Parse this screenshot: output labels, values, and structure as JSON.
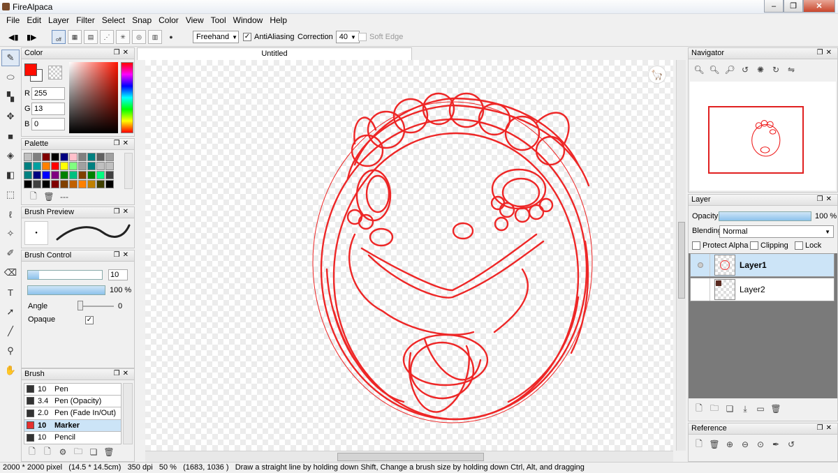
{
  "window": {
    "title": "FireAlpaca",
    "min": "–",
    "max": "❐",
    "close": "✕"
  },
  "menu": [
    "File",
    "Edit",
    "Layer",
    "Filter",
    "Select",
    "Snap",
    "Color",
    "View",
    "Tool",
    "Window",
    "Help"
  ],
  "toolbar": {
    "brush_mode": "Freehand",
    "antialiasing_label": "AntiAliasing",
    "antialiasing_checked": true,
    "correction_label": "Correction",
    "correction_value": "40",
    "soft_edge_label": "Soft Edge",
    "soft_edge_checked": false,
    "snap_off_label": "off"
  },
  "color_panel": {
    "title": "Color",
    "primary_color": "#ff0d00",
    "r_label": "R",
    "r_value": "255",
    "g_label": "G",
    "g_value": "13",
    "b_label": "B",
    "b_value": "0"
  },
  "palette_panel": {
    "title": "Palette",
    "colors": [
      "#c0c0c0",
      "#808080",
      "#800000",
      "#000000",
      "#000080",
      "#ffc0cb",
      "#808080",
      "#008080",
      "#606060",
      "#a0a0a0",
      "#008080",
      "#00a0a0",
      "#ff8000",
      "#ff0000",
      "#ffff00",
      "#80ff80",
      "#a0a0a0",
      "#008080",
      "#c0c0c0",
      "#c0c0c0",
      "#008080",
      "#000080",
      "#0000ff",
      "#800080",
      "#008000",
      "#00c080",
      "#804000",
      "#008000",
      "#00ff80",
      "#404040",
      "#000000",
      "#404040",
      "#000000",
      "#800000",
      "#804000",
      "#c06000",
      "#ff8000",
      "#c08000",
      "#404000",
      "#000000"
    ],
    "empty_label": "---"
  },
  "brush_preview_panel": {
    "title": "Brush Preview"
  },
  "brush_control_panel": {
    "title": "Brush Control",
    "size_value": "10",
    "opacity_value": "100 %",
    "opacity_level": 1.0,
    "size_level": 0.15,
    "angle_label": "Angle",
    "angle_value": "0",
    "opaque_label": "Opaque",
    "opaque_checked": true
  },
  "brush_panel": {
    "title": "Brush",
    "items": [
      {
        "size": "10",
        "name": "Pen",
        "color": "#333333"
      },
      {
        "size": "3.4",
        "name": "Pen (Opacity)",
        "color": "#333333"
      },
      {
        "size": "2.0",
        "name": "Pen (Fade In/Out)",
        "color": "#333333"
      },
      {
        "size": "10",
        "name": "Marker",
        "color": "#e53030",
        "selected": true
      },
      {
        "size": "10",
        "name": "Pencil",
        "color": "#333333"
      }
    ]
  },
  "document": {
    "tab_title": "Untitled"
  },
  "navigator_panel": {
    "title": "Navigator"
  },
  "layer_panel": {
    "title": "Layer",
    "opacity_label": "Opacity",
    "opacity_value": "100 %",
    "opacity_level": 1.0,
    "blending_label": "Blending",
    "blending_value": "Normal",
    "protect_alpha_label": "Protect Alpha",
    "clipping_label": "Clipping",
    "lock_label": "Lock",
    "layers": [
      {
        "name": "Layer1",
        "selected": true
      },
      {
        "name": "Layer2",
        "selected": false
      }
    ]
  },
  "reference_panel": {
    "title": "Reference"
  },
  "status": {
    "image_size": "2000 * 2000 pixel",
    "physical_size": "(14.5 * 14.5cm)",
    "dpi": "350 dpi",
    "zoom": "50 %",
    "coords": "(1683, 1036 )",
    "hint": "Draw a straight line by holding down Shift, Change a brush size by holding down Ctrl, Alt, and dragging"
  }
}
